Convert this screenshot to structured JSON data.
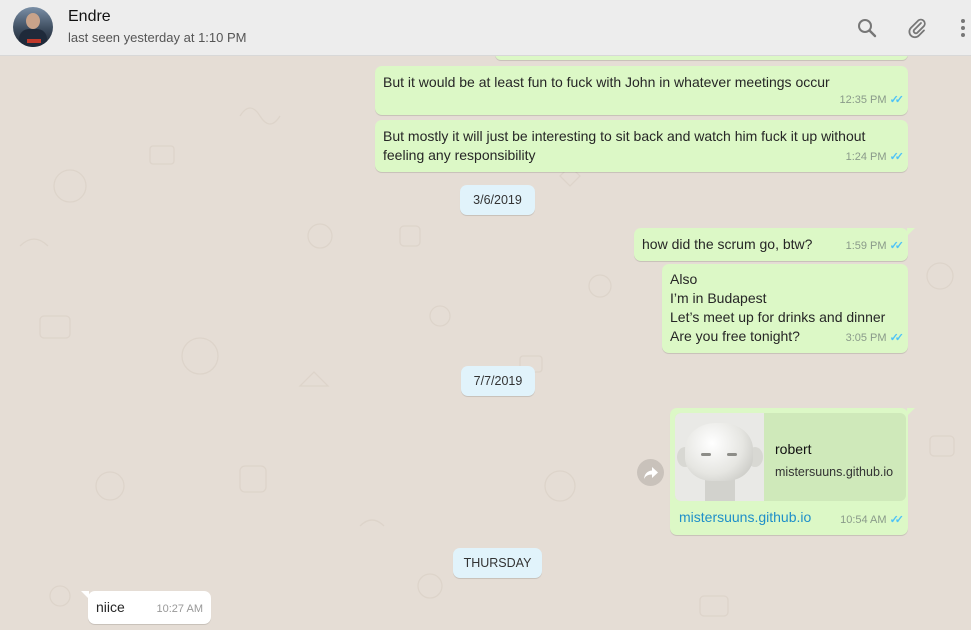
{
  "header": {
    "contact_name": "Endre",
    "last_seen": "last seen yesterday at 1:10 PM",
    "icons": [
      "search-icon",
      "attach-icon",
      "menu-icon"
    ]
  },
  "colors": {
    "outgoing_bubble": "#dcf8c6",
    "incoming_bubble": "#ffffff",
    "date_pill": "#e1f3fb",
    "read_tick": "#4fc3f7",
    "link": "#1f8fc9",
    "wallpaper": "#e5ddd5"
  },
  "messages": [
    {
      "text": "But it would be at least fun to fuck with John in whatever meetings occur",
      "time": "12:35 PM"
    },
    {
      "text": "But mostly it will just be interesting to sit back and watch him fuck it up without\nfeeling any responsibility",
      "time": "1:24 PM"
    },
    {
      "text": "how did the scrum go, btw?",
      "time": "1:59 PM"
    },
    {
      "text": "Also\nI’m in Budapest\nLet’s meet up for drinks and dinner\nAre you free tonight?",
      "time": "3:05 PM"
    },
    {
      "link_title": "robert",
      "link_domain": "mistersuuns.github.io",
      "link_text": "mistersuuns.github.io",
      "time": "10:54 AM"
    },
    {
      "text": "niice",
      "time": "10:27 AM"
    }
  ],
  "dates": [
    "3/6/2019",
    "7/7/2019",
    "THURSDAY"
  ]
}
